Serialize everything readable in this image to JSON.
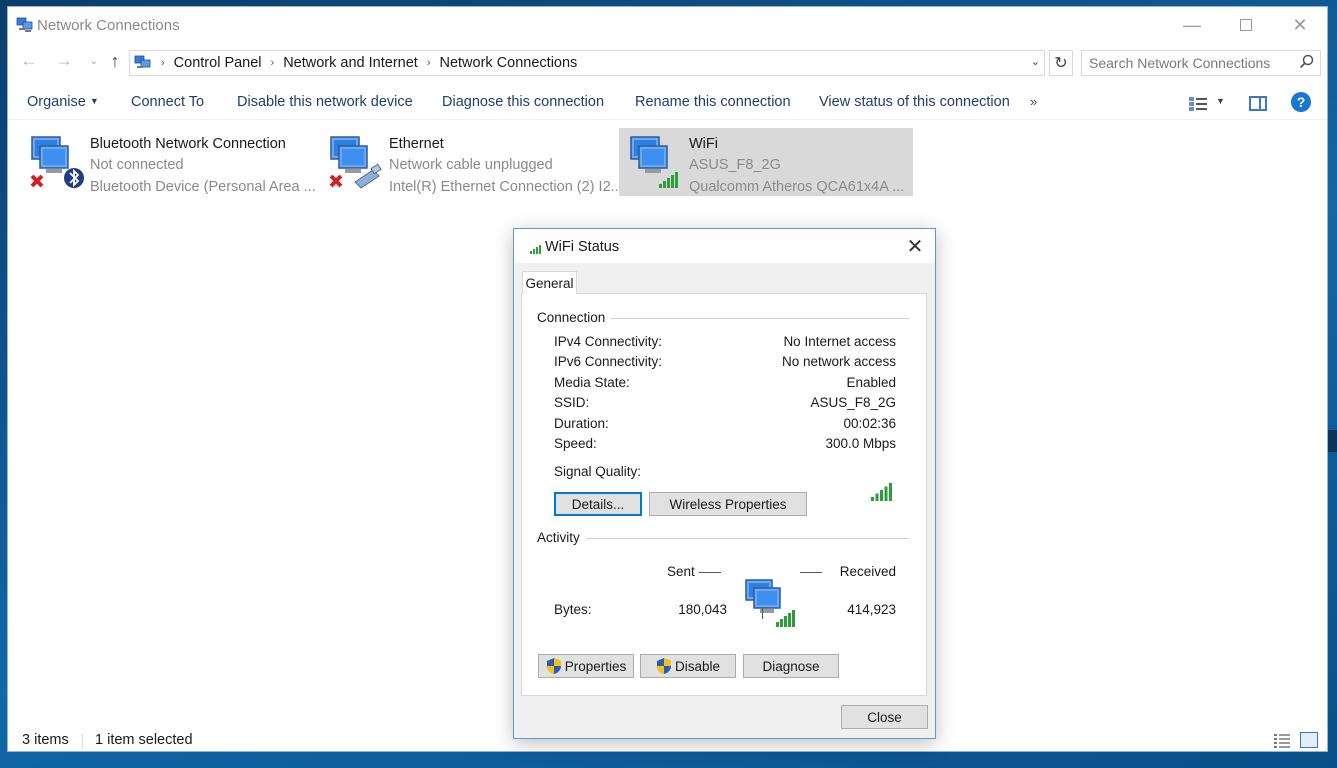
{
  "window": {
    "title": "Network Connections",
    "controls": {
      "minimize": "—",
      "close": "✕"
    }
  },
  "nav": {
    "back": "←",
    "forward": "→",
    "recent": "⌄",
    "up": "↑",
    "breadcrumbs": [
      "Control Panel",
      "Network and Internet",
      "Network Connections"
    ],
    "breadcrumb_sep": "›",
    "dropdown": "⌄",
    "refresh": "↻",
    "search_placeholder": "Search Network Connections"
  },
  "toolbar": {
    "organise": "Organise",
    "connect_to": "Connect To",
    "disable_device": "Disable this network device",
    "diagnose": "Diagnose this connection",
    "rename": "Rename this connection",
    "view_status": "View status of this connection",
    "more": "»",
    "help": "?"
  },
  "connections": [
    {
      "name": "Bluetooth Network Connection",
      "status": "Not connected",
      "device": "Bluetooth Device (Personal Area ...",
      "selected": false
    },
    {
      "name": "Ethernet",
      "status": "Network cable unplugged",
      "device": "Intel(R) Ethernet Connection (2) I2...",
      "selected": false
    },
    {
      "name": "WiFi",
      "status": "ASUS_F8_2G",
      "device": "Qualcomm Atheros QCA61x4A ...",
      "selected": true
    }
  ],
  "statusbar": {
    "items": "3 items",
    "selected": "1 item selected"
  },
  "dialog": {
    "title": "WiFi Status",
    "close_glyph": "✕",
    "tab": "General",
    "connection_group": "Connection",
    "rows": [
      {
        "label": "IPv4 Connectivity:",
        "value": "No Internet access"
      },
      {
        "label": "IPv6 Connectivity:",
        "value": "No network access"
      },
      {
        "label": "Media State:",
        "value": "Enabled"
      },
      {
        "label": "SSID:",
        "value": "ASUS_F8_2G"
      },
      {
        "label": "Duration:",
        "value": "00:02:36"
      },
      {
        "label": "Speed:",
        "value": "300.0 Mbps"
      }
    ],
    "signal_label": "Signal Quality:",
    "signal_bars": 5,
    "details_btn": "Details...",
    "wireless_props_btn": "Wireless Properties",
    "activity_group": "Activity",
    "sent_label": "Sent",
    "received_label": "Received",
    "bytes_label": "Bytes:",
    "bytes_sent": "180,043",
    "bytes_received": "414,923",
    "properties_btn": "Properties",
    "disable_btn": "Disable",
    "diagnose_btn": "Diagnose",
    "close_btn": "Close"
  },
  "colors": {
    "accent": "#0078d7",
    "link_text": "#1e3f6e",
    "selected_bg": "#d9d9d9",
    "signal_green": "#2e9e3a",
    "error_red": "#d42020"
  }
}
